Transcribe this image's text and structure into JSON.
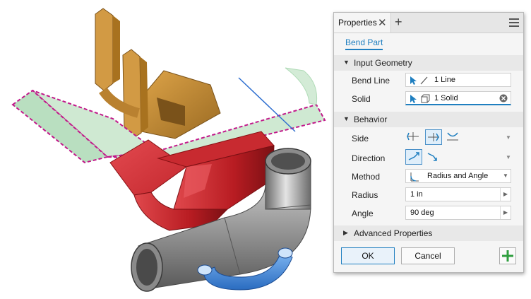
{
  "tab": {
    "label": "Properties",
    "close_glyph": "✕",
    "add_glyph": "+"
  },
  "feature_name": "Bend Part",
  "sections": {
    "input_geometry": "Input Geometry",
    "behavior": "Behavior",
    "advanced": "Advanced Properties"
  },
  "input_geometry": {
    "bend_line_label": "Bend Line",
    "bend_line_value": "1 Line",
    "solid_label": "Solid",
    "solid_value": "1 Solid"
  },
  "behavior": {
    "side_label": "Side",
    "direction_label": "Direction",
    "method_label": "Method",
    "method_value": "Radius and Angle",
    "radius_label": "Radius",
    "radius_value": "1 in",
    "angle_label": "Angle",
    "angle_value": "90 deg"
  },
  "buttons": {
    "ok": "OK",
    "cancel": "Cancel"
  },
  "colors": {
    "accent": "#1f7fc0",
    "add_green": "#2e9e3e",
    "gold_part": "#c08a36",
    "red_part": "#c8222a",
    "pipe_gray": "#9a9a9a",
    "blue_part": "#3d86d8",
    "sheet_green": "#cfe9d2",
    "highlight_magenta": "#c2188a"
  },
  "icons": [
    "close-icon",
    "plus-icon",
    "hamburger-menu-icon",
    "cursor-arrow-icon",
    "line-icon",
    "solid-cube-icon",
    "clear-icon",
    "side-icons",
    "direction-icons",
    "bend-method-icon"
  ]
}
